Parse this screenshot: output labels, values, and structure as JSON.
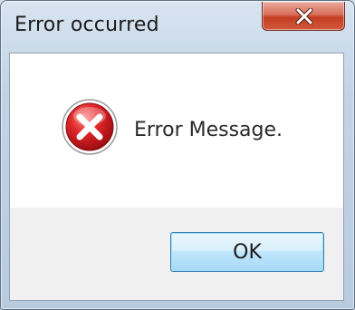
{
  "window": {
    "title": "Error occurred",
    "close_icon": "close-icon"
  },
  "dialog": {
    "icon": "error-icon",
    "message": "Error Message.",
    "ok_label": "OK"
  },
  "colors": {
    "close_button_red": "#c33d22",
    "error_icon_red": "#c8141a",
    "ok_button_border": "#3c7fb1"
  }
}
